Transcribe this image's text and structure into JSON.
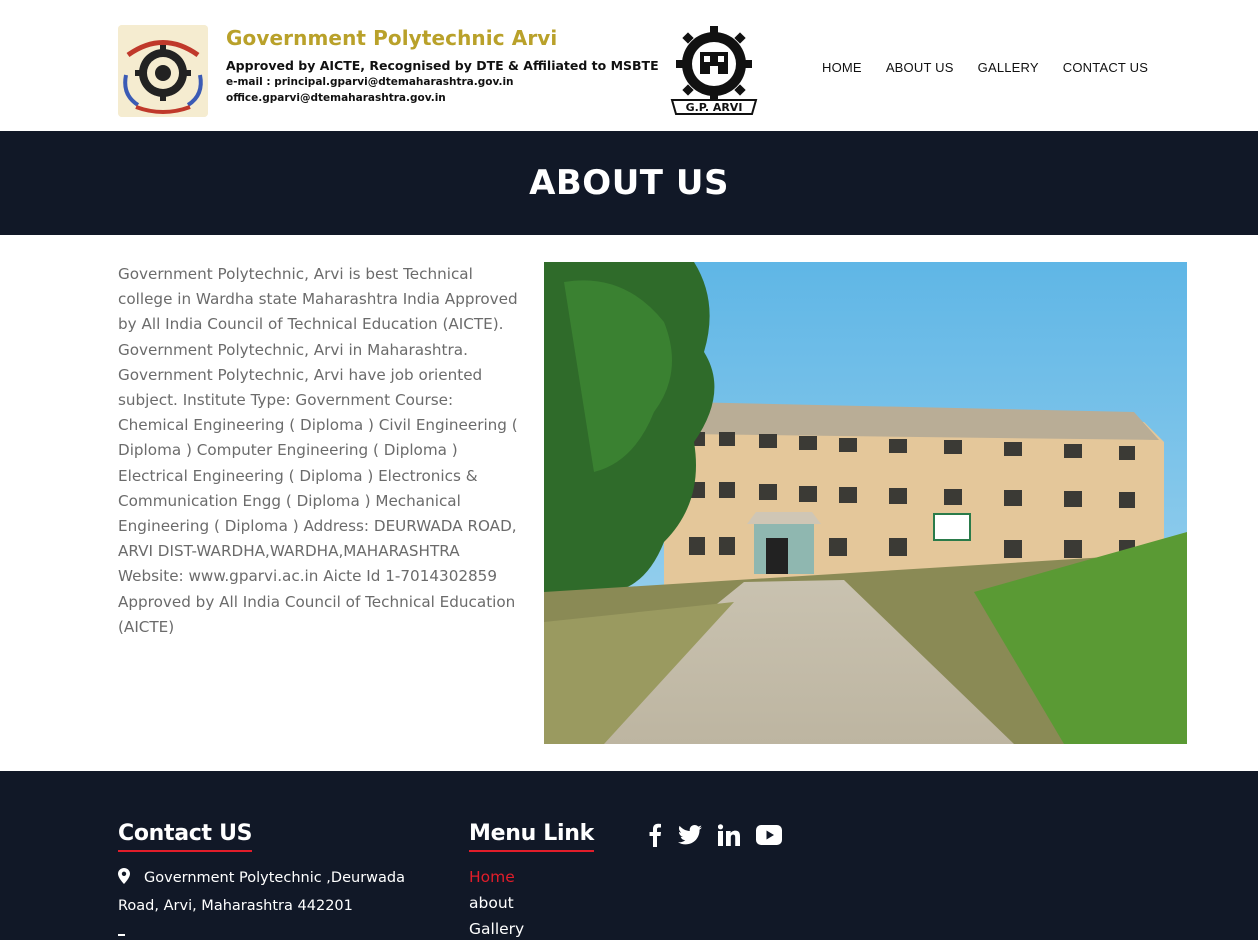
{
  "header": {
    "title": "Government Polytechnic Arvi",
    "subtitle": "Approved by AICTE, Recognised by DTE & Affiliated to MSBTE",
    "email_line1": "e-mail : principal.gparvi@dtemaharashtra.gov.in",
    "email_line2": "office.gparvi@dtemaharashtra.gov.in",
    "right_logo_text": "G.P. ARVI"
  },
  "nav": {
    "items": [
      {
        "label": "HOME"
      },
      {
        "label": "ABOUT US"
      },
      {
        "label": "GALLERY"
      },
      {
        "label": "CONTACT US"
      }
    ]
  },
  "banner": {
    "title": "ABOUT US"
  },
  "about": {
    "text": "Government Polytechnic, Arvi is best Technical college in Wardha state Maharashtra India Approved by All India Council of Technical Education (AICTE). Government Polytechnic, Arvi in Maharashtra. Government Polytechnic, Arvi have job oriented subject. Institute Type: Government Course: Chemical Engineering ( Diploma ) Civil Engineering ( Diploma ) Computer Engineering ( Diploma ) Electrical Engineering ( Diploma ) Electronics & Communication Engg ( Diploma ) Mechanical Engineering ( Diploma ) Address: DEURWADA ROAD, ARVI DIST-WARDHA,WARDHA,MAHARASHTRA Website: www.gparvi.ac.in Aicte Id 1-7014302859 Approved by All India Council of Technical Education (AICTE)"
  },
  "footer": {
    "contact_heading": "Contact US",
    "address": "Government Polytechnic ,Deurwada Road, Arvi, Maharashtra 442201",
    "menu_heading": "Menu Link",
    "menu_items": [
      {
        "label": "Home"
      },
      {
        "label": "about"
      },
      {
        "label": "Gallery"
      }
    ],
    "social_icons": [
      "facebook-icon",
      "twitter-icon",
      "linkedin-icon",
      "youtube-icon"
    ]
  },
  "colors": {
    "brand_gold": "#b9a12a",
    "dark_bg": "#111827",
    "accent_red": "#e11d2a",
    "body_text": "#6b6b6b"
  }
}
